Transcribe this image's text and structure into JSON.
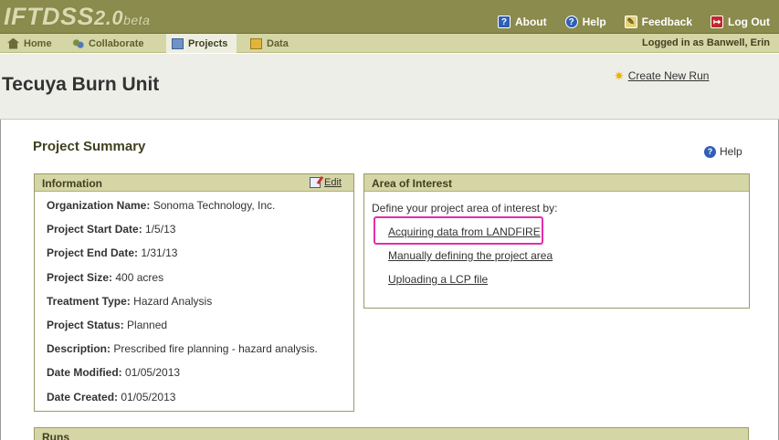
{
  "app": {
    "logo_main": "IFTDSS",
    "logo_version": "2.0",
    "logo_suffix": "beta"
  },
  "toplinks": [
    {
      "label": "About",
      "icon": "about-icon"
    },
    {
      "label": "Help",
      "icon": "help-icon"
    },
    {
      "label": "Feedback",
      "icon": "feedback-icon"
    },
    {
      "label": "Log Out",
      "icon": "logout-icon"
    }
  ],
  "nav": {
    "tabs": [
      {
        "label": "Home",
        "icon": "home-icon"
      },
      {
        "label": "Collaborate",
        "icon": "collaborate-icon"
      },
      {
        "label": "Projects",
        "icon": "projects-icon",
        "active": true
      },
      {
        "label": "Data",
        "icon": "data-icon"
      }
    ],
    "logged_in": "Logged in as Banwell, Erin"
  },
  "page": {
    "title": "Tecuya Burn Unit",
    "create_run": "Create New Run",
    "summary_heading": "Project Summary",
    "help": "Help"
  },
  "info": {
    "heading": "Information",
    "edit": "Edit",
    "rows": [
      {
        "label": "Organization Name:",
        "value": "Sonoma Technology, Inc."
      },
      {
        "label": "Project Start Date:",
        "value": "1/5/13"
      },
      {
        "label": "Project End Date:",
        "value": "1/31/13"
      },
      {
        "label": "Project Size:",
        "value": "400 acres"
      },
      {
        "label": "Treatment Type:",
        "value": "Hazard Analysis"
      },
      {
        "label": "Project Status:",
        "value": "Planned"
      },
      {
        "label": "Description:",
        "value": "Prescribed fire planning - hazard analysis."
      },
      {
        "label": "Date Modified:",
        "value": "01/05/2013"
      },
      {
        "label": "Date Created:",
        "value": "01/05/2013"
      }
    ]
  },
  "aoi": {
    "heading": "Area of Interest",
    "intro": "Define your project area of interest by:",
    "links": [
      "Acquiring data from LANDFIRE",
      "Manually defining the project area",
      "Uploading a LCP file"
    ],
    "highlight_color": "#e32ea9"
  },
  "runs": {
    "heading": "Runs"
  },
  "colors": {
    "header_bg": "#8a8b4c",
    "nav_bg": "#d5d6a5",
    "panel_head": "#d5d6a5"
  }
}
